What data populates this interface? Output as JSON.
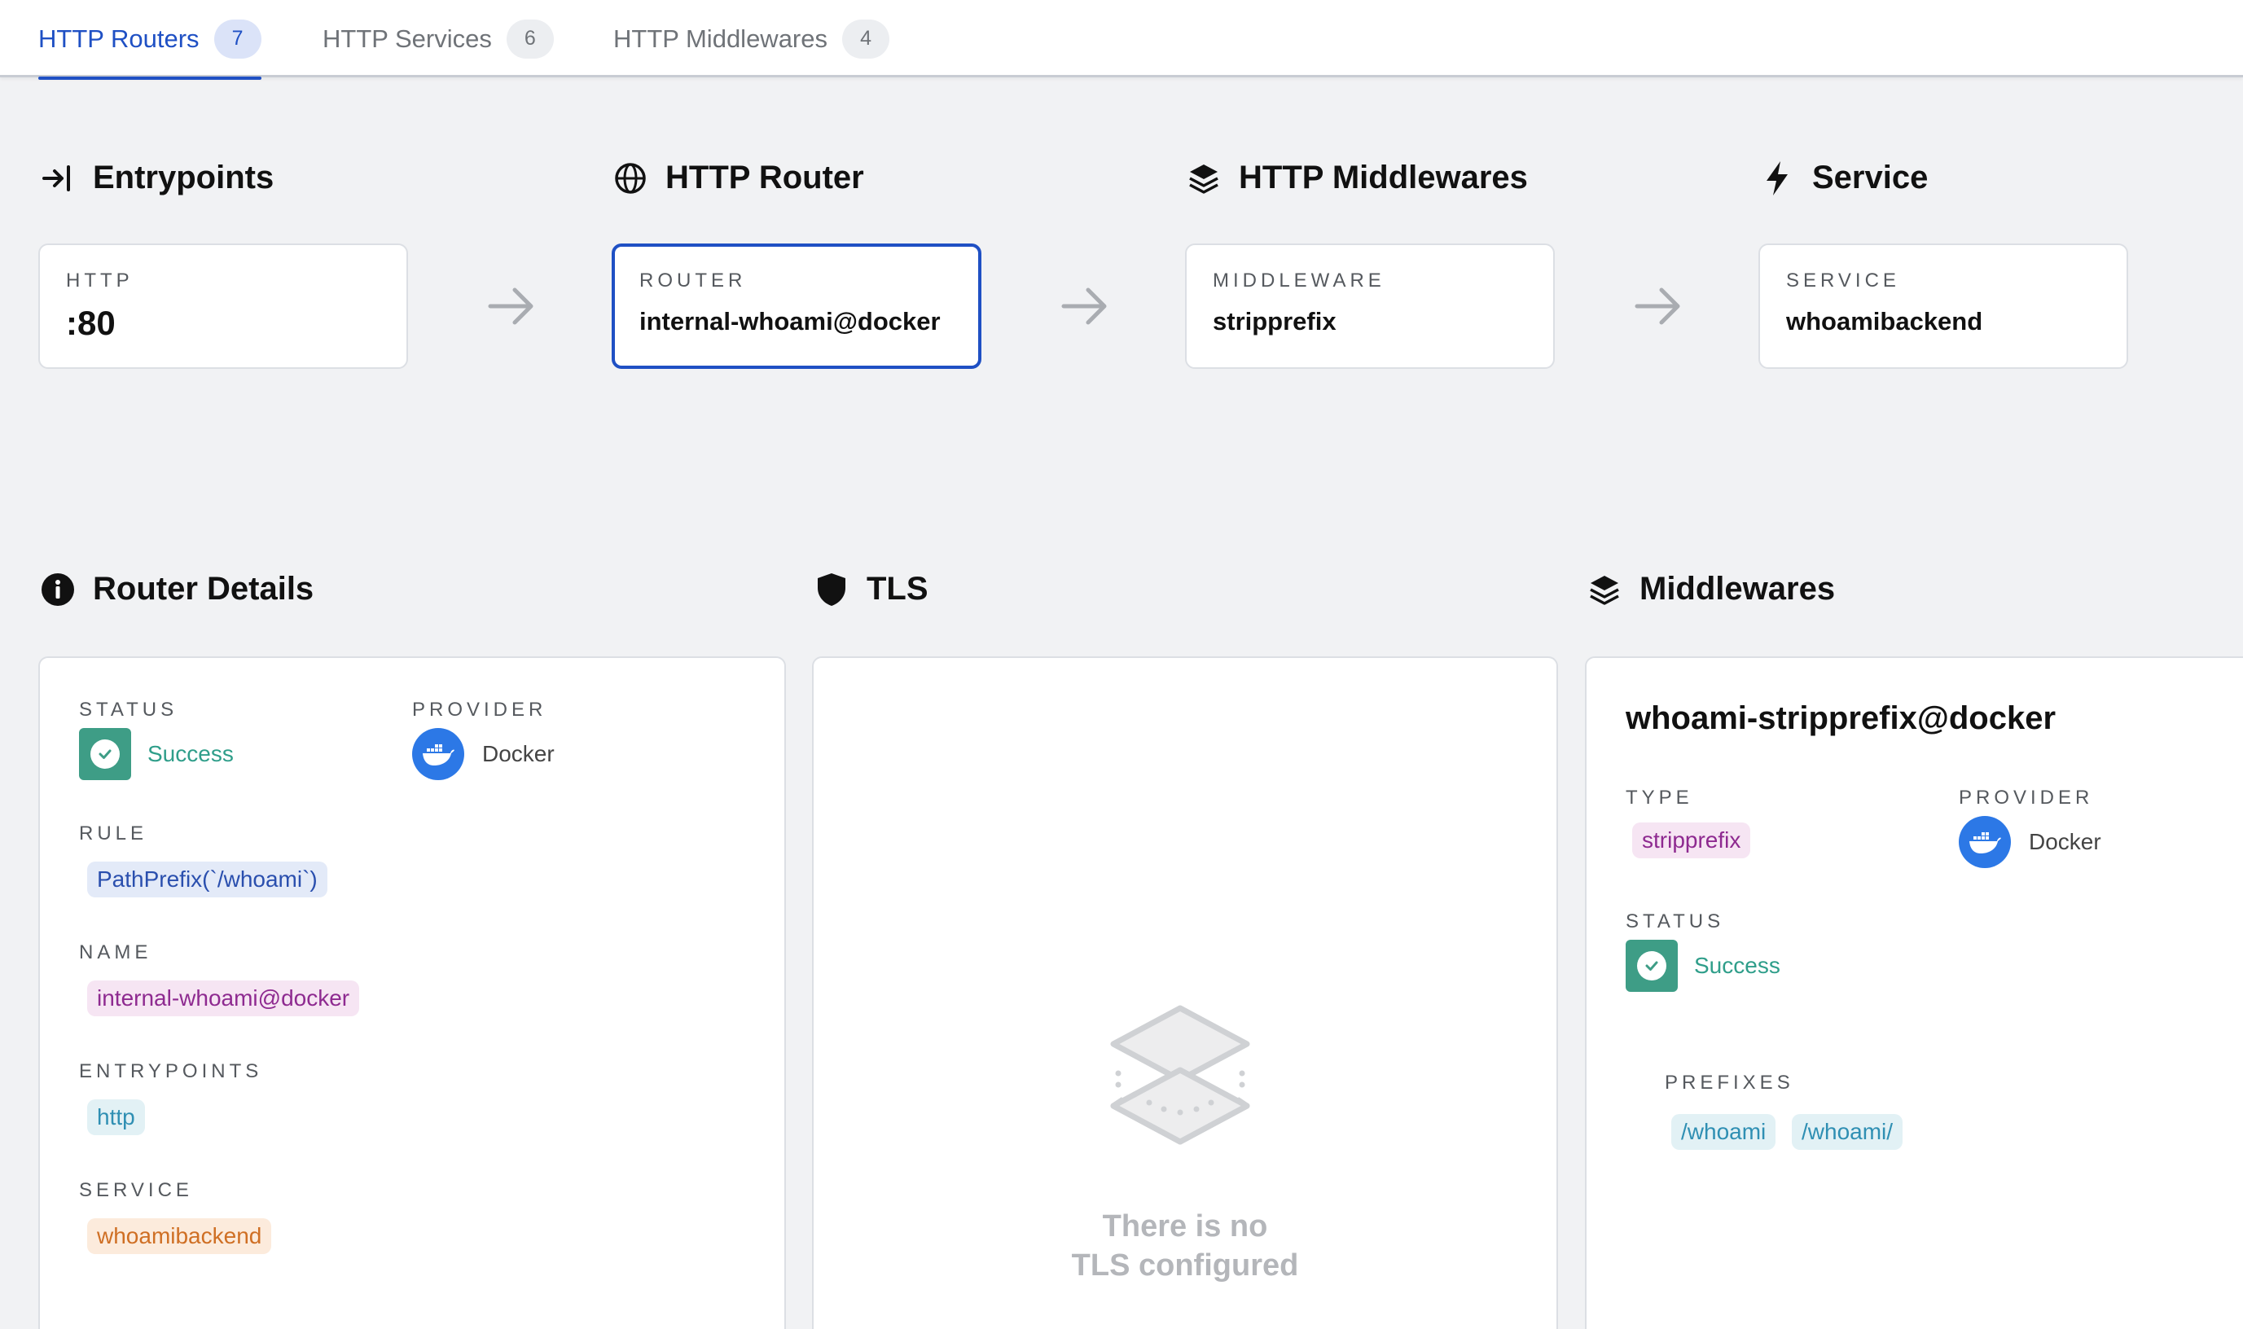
{
  "tabs": [
    {
      "label": "HTTP Routers",
      "count": "7"
    },
    {
      "label": "HTTP Services",
      "count": "6"
    },
    {
      "label": "HTTP Middlewares",
      "count": "4"
    }
  ],
  "flow": {
    "entrypoints": {
      "title": "Entrypoints",
      "label": "HTTP",
      "value": ":80"
    },
    "router": {
      "title": "HTTP Router",
      "label": "ROUTER",
      "value": "internal-whoami@docker"
    },
    "middlewares": {
      "title": "HTTP Middlewares",
      "label": "MIDDLEWARE",
      "value": "stripprefix"
    },
    "service": {
      "title": "Service",
      "label": "SERVICE",
      "value": "whoamibackend"
    }
  },
  "router_details": {
    "title": "Router Details",
    "status_label": "STATUS",
    "status_value": "Success",
    "provider_label": "PROVIDER",
    "provider_value": "Docker",
    "rule_label": "RULE",
    "rule_value": "PathPrefix(`/whoami`)",
    "name_label": "NAME",
    "name_value": "internal-whoami@docker",
    "entrypoints_label": "ENTRYPOINTS",
    "entrypoints_value": "http",
    "service_label": "SERVICE",
    "service_value": "whoamibackend"
  },
  "tls": {
    "title": "TLS",
    "empty_line1": "There is no",
    "empty_line2": "TLS configured"
  },
  "middlewares_panel": {
    "title": "Middlewares",
    "name": "whoami-stripprefix@docker",
    "type_label": "TYPE",
    "type_value": "stripprefix",
    "provider_label": "PROVIDER",
    "provider_value": "Docker",
    "status_label": "STATUS",
    "status_value": "Success",
    "prefixes_label": "PREFIXES",
    "prefixes": [
      "/whoami",
      "/whoami/"
    ]
  },
  "colors": {
    "accent": "#1f50c4",
    "success": "#3e9d86",
    "docker": "#2c78e6"
  }
}
